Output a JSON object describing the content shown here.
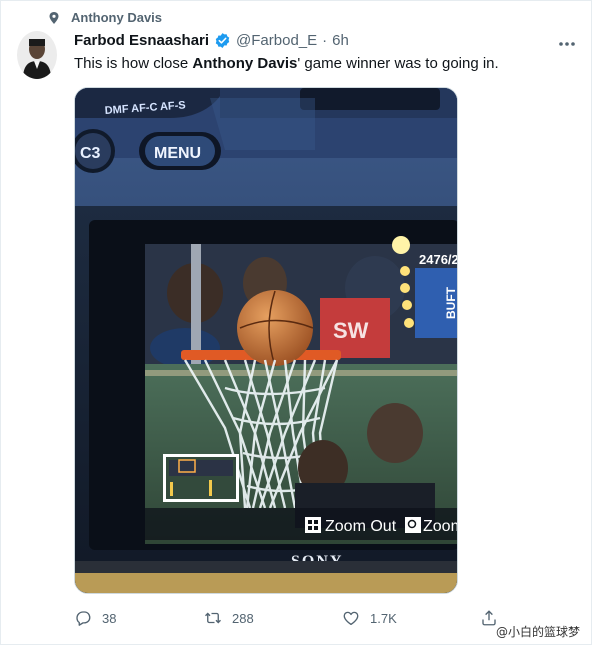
{
  "social_context": {
    "label": "Anthony Davis"
  },
  "tweet": {
    "author_name": "Farbod Esnaashari",
    "handle": "@Farbod_E",
    "separator": "·",
    "time": "6h",
    "text_before": "This is how close ",
    "text_bold": "Anthony Davis",
    "text_after": "' game winner was to going in."
  },
  "media": {
    "camera_labels": {
      "dial": "DMF AF-C AF-S",
      "c3_button": "C3",
      "menu_button": "MENU",
      "brand": "SONY",
      "counter": "2476/2",
      "zoom_out": "Zoom Out",
      "zoom": "Zoom"
    },
    "overlay_graphics": {
      "sign_text": "SW",
      "board_text": "BUFT"
    }
  },
  "actions": {
    "reply_count": "38",
    "retweet_count": "288",
    "like_count": "1.7K"
  },
  "watermark": {
    "text": "@小白的篮球梦"
  },
  "colors": {
    "verified_blue": "#1d9bf0",
    "muted_text": "#536471",
    "primary_text": "#0f1419"
  }
}
